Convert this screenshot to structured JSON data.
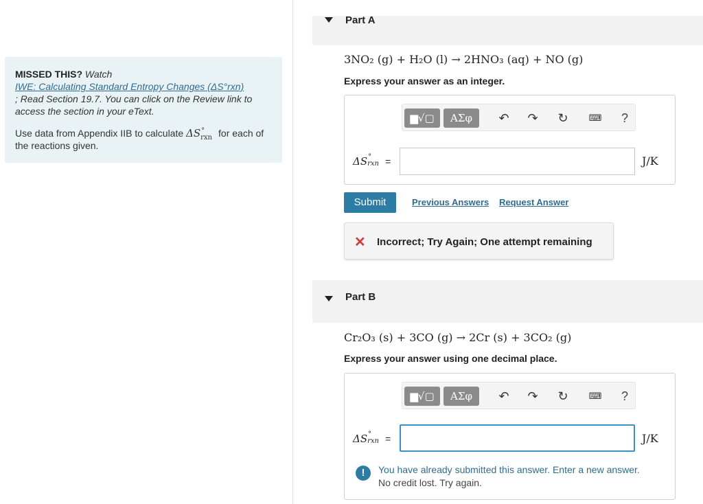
{
  "hint": {
    "missed_label": "MISSED THIS?",
    "watch_label": "Watch",
    "video_link": "IWE: Calculating Standard Entropy Changes (ΔS°rxn)",
    "read_text": "; Read Section 19.7. You can click on the Review link to access the section in your eText.",
    "instruction_before": "Use data from Appendix IIB to calculate",
    "instruction_symbol": "ΔS",
    "instruction_sup": "°",
    "instruction_sub": "rxn",
    "instruction_after": "for each of the reactions given."
  },
  "part_a": {
    "title": "Part A",
    "equation": "3NO₂ (g) + H₂O (l) → 2HNO₃ (aq) + NO (g)",
    "instruction": "Express your answer as an integer.",
    "lhs_symbol": "ΔS",
    "lhs_sup": "°",
    "lhs_sub": "rxn",
    "lhs_equals": "=",
    "input_value": "",
    "unit": "J/K",
    "submit_label": "Submit",
    "previous_answers_label": "Previous Answers",
    "request_answer_label": "Request Answer",
    "feedback_message": "Incorrect; Try Again; One attempt remaining"
  },
  "part_b": {
    "title": "Part B",
    "equation": "Cr₂O₃ (s) + 3CO (g) → 2Cr (s) + 3CO₂ (g)",
    "instruction": "Express your answer using one decimal place.",
    "lhs_symbol": "ΔS",
    "lhs_sup": "°",
    "lhs_sub": "rxn",
    "lhs_equals": "=",
    "input_value": "",
    "unit": "J/K",
    "notice_line1": "You have already submitted this answer. Enter a new answer.",
    "notice_line2": "No credit lost. Try again."
  },
  "toolbar": {
    "template_label": "▆√▢",
    "greek_label": "ΑΣφ",
    "undo_glyph": "↶",
    "redo_glyph": "↷",
    "reset_glyph": "↻",
    "keyboard_glyph": "⌨",
    "help_glyph": "?"
  },
  "colors": {
    "accent": "#2d7ca3",
    "link": "#2e6c91",
    "error": "#d23a3a",
    "hint_bg": "#e9f3f5"
  }
}
